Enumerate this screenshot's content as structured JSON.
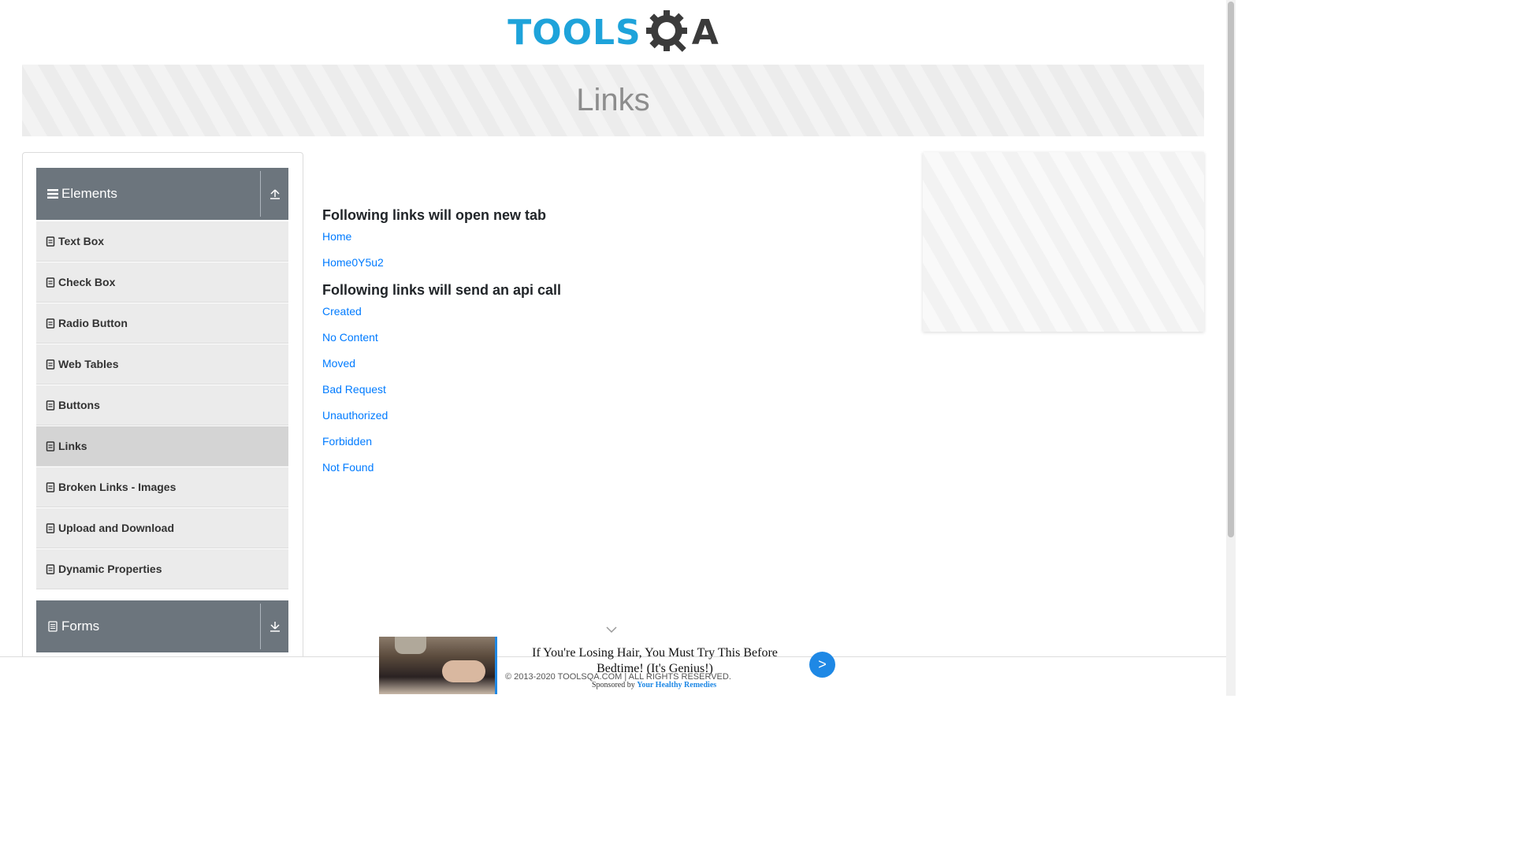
{
  "header": {
    "logo_text": "TOOLS",
    "logo_text_end": "A",
    "logo_icon": "gear-q-icon"
  },
  "banner": {
    "title": "Links"
  },
  "sidebar": {
    "elements_group": {
      "label": "Elements",
      "icon": "hamburger-icon",
      "toggle_icon": "collapse-up-icon"
    },
    "items": [
      {
        "label": "Text Box",
        "icon": "doc-icon"
      },
      {
        "label": "Check Box",
        "icon": "doc-icon"
      },
      {
        "label": "Radio Button",
        "icon": "doc-icon"
      },
      {
        "label": "Web Tables",
        "icon": "doc-icon"
      },
      {
        "label": "Buttons",
        "icon": "doc-icon"
      },
      {
        "label": "Links",
        "icon": "doc-icon",
        "active": true
      },
      {
        "label": "Broken Links - Images",
        "icon": "doc-icon"
      },
      {
        "label": "Upload and Download",
        "icon": "doc-icon"
      },
      {
        "label": "Dynamic Properties",
        "icon": "doc-icon"
      }
    ],
    "forms_group": {
      "label": "Forms",
      "icon": "form-icon",
      "toggle_icon": "expand-down-icon"
    }
  },
  "main": {
    "new_tab_heading": "Following links will open new tab",
    "new_tab_links": [
      "Home",
      "Home0Y5u2"
    ],
    "api_heading": "Following links will send an api call",
    "api_links": [
      "Created",
      "No Content",
      "Moved",
      "Bad Request",
      "Unauthorized",
      "Forbidden",
      "Not Found"
    ]
  },
  "sponsor_ad": {
    "title": "If You're Losing Hair, You Must Try This Before Bedtime! (It's Genius!)",
    "sponsored_prefix": "Sponsored by",
    "sponsor_name": "Your Healthy Remedies",
    "next_label": ">"
  },
  "footer": {
    "copyright": "© 2013-2020 TOOLSQA.COM | ALL RIGHTS RESERVED."
  },
  "colors": {
    "link": "#007bff",
    "sidebar_header": "#6c757d",
    "logo_blue": "#1ea3da"
  }
}
